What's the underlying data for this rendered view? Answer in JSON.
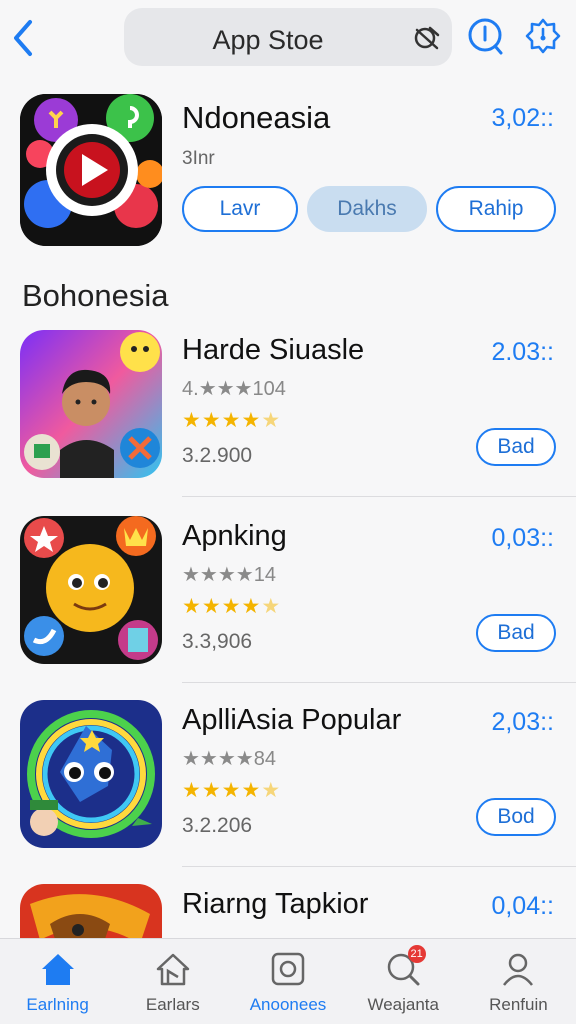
{
  "header": {
    "search_label": "App Stoe"
  },
  "featured": {
    "title": "Ndoneasia",
    "subtitle": "3Inr",
    "price": "3,02::",
    "buttons": [
      {
        "label": "Lavr"
      },
      {
        "label": "Dakhs"
      },
      {
        "label": "Rahip"
      }
    ]
  },
  "section": {
    "title": "Bohonesia"
  },
  "apps": [
    {
      "name": "Harde Siuasle",
      "price": "2.03::",
      "meta_prefix": "4.",
      "meta_stars": "★★★",
      "meta_suffix": "104",
      "stars": "★★★★",
      "stars_half": "★",
      "count": "3.2.900",
      "button": "Bad"
    },
    {
      "name": "Apnking",
      "price": "0,03::",
      "meta_prefix": "",
      "meta_stars": "★★★★",
      "meta_suffix": "14",
      "stars": "★★★★",
      "stars_half": "★",
      "count": "3.3,906",
      "button": "Bad"
    },
    {
      "name": "AplliAsia Popular",
      "price": "2,03::",
      "meta_prefix": "",
      "meta_stars": "★★★★",
      "meta_suffix": "84",
      "stars": "★★★★",
      "stars_half": "★",
      "count": "3.2.206",
      "button": "Bod"
    },
    {
      "name": "Riarng Tapkior",
      "price": "0,04::"
    }
  ],
  "tabbar": [
    {
      "label": "Earlning",
      "icon": "home-icon"
    },
    {
      "label": "Earlars",
      "icon": "games-icon"
    },
    {
      "label": "Anoonees",
      "icon": "apps-icon"
    },
    {
      "label": "Weajanta",
      "icon": "search-icon",
      "badge": "21"
    },
    {
      "label": "Renfuin",
      "icon": "profile-icon"
    }
  ],
  "colors": {
    "accent": "#1e7cf2",
    "star": "#f4b400",
    "badge": "#e53935"
  }
}
